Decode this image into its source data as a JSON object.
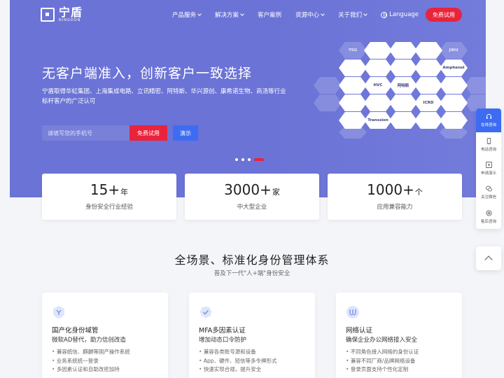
{
  "nav": {
    "logo_cn": "宁盾",
    "logo_en": "NINGDON",
    "items": [
      {
        "label": "产品服务",
        "dropdown": true
      },
      {
        "label": "解决方案",
        "dropdown": true
      },
      {
        "label": "客户案例",
        "dropdown": false
      },
      {
        "label": "资源中心",
        "dropdown": true
      },
      {
        "label": "关于我们",
        "dropdown": true
      }
    ],
    "language": "Language",
    "trial_label": "免费试用"
  },
  "hero": {
    "title": "无客户端准入，创新客户一致选择",
    "desc": "宁盾取得华虹集团、上海集成电路、立讯精密、阿特斯、华兴源创、康希诺生物、商汤等行业标杆客户的广泛认可",
    "phone_placeholder": "请填写您的手机号",
    "free_btn": "免费试用",
    "demo_btn": "演示",
    "logos": [
      "Y5G",
      "JIDU",
      "Amphenol",
      "HVC",
      "阿特斯",
      "ICRD",
      "Transsion",
      "COSCO",
      "立讯精密",
      "WeChat"
    ]
  },
  "stats": [
    {
      "num": "15+",
      "unit": "年",
      "label": "身份安全行业经验"
    },
    {
      "num": "3000+",
      "unit": "家",
      "label": "中大型企业"
    },
    {
      "num": "1000+",
      "unit": "个",
      "label": "应用兼容能力"
    }
  ],
  "side": {
    "items": [
      {
        "label": "在线咨询",
        "icon": "headset-icon",
        "active": true
      },
      {
        "label": "电话咨询",
        "icon": "phone-icon",
        "active": false
      },
      {
        "label": "申请演示",
        "icon": "play-icon",
        "active": false
      },
      {
        "label": "关注微信",
        "icon": "wechat-icon",
        "active": false
      },
      {
        "label": "售后咨询",
        "icon": "support-icon",
        "active": false
      }
    ]
  },
  "section": {
    "title": "全场景、标准化身份管理体系",
    "subtitle": "普及下一代\"人+端\"身份安全"
  },
  "cards": [
    {
      "title": "国产化身份域管",
      "sub": "微软AD替代，助力信创改造",
      "icon": "shield-y-icon",
      "items": [
        "兼容统信、麒麟等国产操作系统",
        "业务系统统一登录",
        "多因素认证和自助改密加持"
      ]
    },
    {
      "title": "MFA多因素认证",
      "sub": "增加动态口令防护",
      "icon": "check-badge-icon",
      "items": [
        "兼容各类账号源和设备",
        "App、硬件、短信等多令牌形式",
        "快速实现合规，提升安全"
      ]
    },
    {
      "title": "网络认证",
      "sub": "确保企业办公网络接入安全",
      "icon": "network-icon",
      "items": [
        "不同角色接入网络的身份认证",
        "兼容不同厂商/品牌网络设备",
        "登录页面支持个性化定制"
      ]
    }
  ],
  "colors": {
    "accent": "#3d6cf3",
    "brand_red": "#e9233b",
    "hero_bg": "#6b73d6"
  }
}
